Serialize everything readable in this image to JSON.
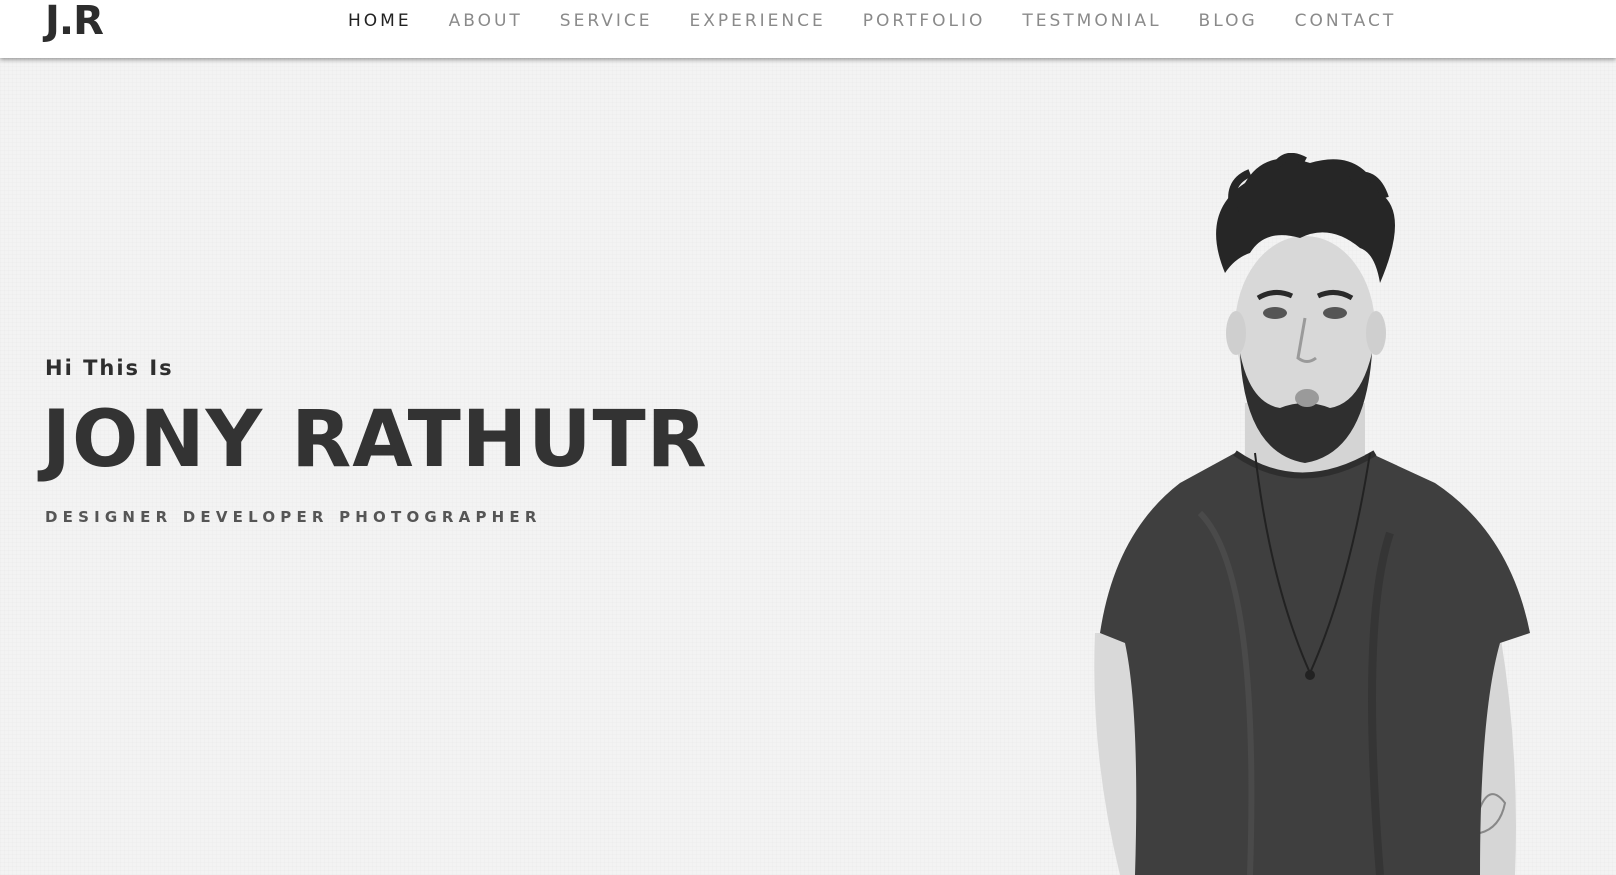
{
  "header": {
    "logo": "J.R",
    "nav": [
      {
        "label": "HOME",
        "active": true
      },
      {
        "label": "ABOUT",
        "active": false
      },
      {
        "label": "SERVICE",
        "active": false
      },
      {
        "label": "EXPERIENCE",
        "active": false
      },
      {
        "label": "PORTFOLIO",
        "active": false
      },
      {
        "label": "TESTMONIAL",
        "active": false
      },
      {
        "label": "BLOG",
        "active": false
      },
      {
        "label": "CONTACT",
        "active": false
      }
    ]
  },
  "hero": {
    "greeting": "Hi This Is",
    "name": "JONY RATHUTR",
    "roles": "DESIGNER DEVELOPER PHOTOGRAPHER"
  },
  "colors": {
    "background": "#f3f3f3",
    "header_bg": "#ffffff",
    "text_dark": "#333333",
    "nav_inactive": "#8a8a8a",
    "nav_active": "#222222",
    "shirt": "#3f3f3f"
  }
}
